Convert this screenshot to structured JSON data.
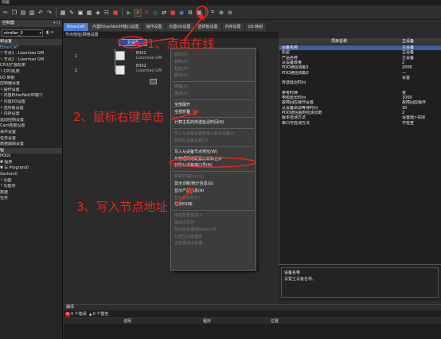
{
  "menubar": {
    "text": "动画"
  },
  "toolbar": {
    "icons": [
      "cut-icon",
      "copy-icon",
      "paste-icon",
      "delete-icon",
      "undo-icon",
      "redo-icon",
      "build-icon",
      "sync-icon",
      "online-icon",
      "offline-icon",
      "grid-icon",
      "zoom-in-icon",
      "zoom-out-icon"
    ]
  },
  "left": {
    "header": "控制器",
    "combo": "ntroller_0",
    "items": [
      {
        "label": "和设置",
        "kind": "cat"
      },
      {
        "label": "EtherCAT",
        "kind": "blue"
      },
      {
        "label": "└ 节点1 : Liaomiao GM",
        "kind": "normal"
      },
      {
        "label": "└ 节点2 : Liaomiao GM",
        "kind": "normal"
      },
      {
        "label": "CPU/扩展机架",
        "kind": "normal"
      },
      {
        "label": "└ CPU机架",
        "kind": "normal"
      },
      {
        "label": "I/O 映射",
        "kind": "normal"
      },
      {
        "label": "控制器设置",
        "kind": "normal"
      },
      {
        "label": "└ 操作设置",
        "kind": "normal"
      },
      {
        "label": "└ 内置EtherNet/IP端口",
        "kind": "normal"
      },
      {
        "label": "└ 内置I/O设置",
        "kind": "normal"
      },
      {
        "label": "└ 选项板设置",
        "kind": "normal"
      },
      {
        "label": "└ 内存设置",
        "kind": "normal"
      },
      {
        "label": "运动控制设置",
        "kind": "normal"
      },
      {
        "label": "Cam数据设置",
        "kind": "normal"
      },
      {
        "label": "事件设置",
        "kind": "normal"
      },
      {
        "label": "任务设置",
        "kind": "normal"
      },
      {
        "label": "数据跟踪设置",
        "kind": "normal"
      },
      {
        "label": "程",
        "kind": "cat"
      },
      {
        "label": "POUs",
        "kind": "normal"
      },
      {
        "label": "▼ 程序",
        "kind": "normal"
      },
      {
        "label": "▼ ☰ Program0",
        "kind": "normal"
      },
      {
        "label": "Section0",
        "kind": "normal"
      },
      {
        "label": "└ 功能",
        "kind": "normal"
      },
      {
        "label": "└ 功能块",
        "kind": "normal"
      },
      {
        "label": "数据",
        "kind": "normal"
      },
      {
        "label": "任务",
        "kind": "normal"
      }
    ]
  },
  "tabs": [
    {
      "label": "EtherCAT",
      "active": true
    },
    {
      "label": "内置EtherNet/IP端口设置",
      "active": false
    },
    {
      "label": "操作设置",
      "active": false
    },
    {
      "label": "内置I/O设置",
      "active": false
    },
    {
      "label": "选项板设置",
      "active": false
    },
    {
      "label": "内存设置",
      "active": false
    },
    {
      "label": "I/O 映射",
      "active": false
    }
  ],
  "breadcrumb": "节点地址|网络设置",
  "topology": {
    "master_label": "主设备",
    "devices": [
      {
        "num": "1",
        "name": "E001",
        "model": "Liaomiao GM"
      },
      {
        "num": "2",
        "name": "E002",
        "model": "Liaomiao GM"
      }
    ]
  },
  "context_menu": [
    {
      "label": "剪切(T)",
      "enabled": false
    },
    {
      "label": "复制(C)",
      "enabled": false
    },
    {
      "label": "粘贴(P)",
      "enabled": false
    },
    {
      "label": "删除(D)",
      "enabled": false
    },
    {
      "sep": true
    },
    {
      "label": "撤销(U)",
      "enabled": false
    },
    {
      "label": "重做(R)",
      "enabled": false
    },
    {
      "sep": true
    },
    {
      "label": "全部展开",
      "enabled": true
    },
    {
      "label": "全部折叠",
      "enabled": true
    },
    {
      "sep": true
    },
    {
      "label": "计算主机的传送延迟时间(N)",
      "enabled": true
    },
    {
      "sep": true
    },
    {
      "label": "导入从设备设置和插入新从设备(I)",
      "enabled": false
    },
    {
      "label": "导出从设备设置(X)",
      "enabled": false
    },
    {
      "sep": true
    },
    {
      "label": "写入从设备节点地址(W)",
      "enabled": true
    },
    {
      "label": "与物理网络配置比较和合并",
      "enabled": true
    },
    {
      "label": "获取从设备串口号(N)",
      "enabled": true
    },
    {
      "sep": true
    },
    {
      "label": "获取终端口计(C)",
      "enabled": false
    },
    {
      "label": "显示诊断/统计信息(G)",
      "enabled": true
    },
    {
      "label": "显示产品信息(A)",
      "enabled": true
    },
    {
      "label": "显示其信息(P)",
      "enabled": false
    },
    {
      "label": "显示ESI库",
      "enabled": true
    },
    {
      "sep": true
    },
    {
      "label": "电缆配置信息(I)",
      "enabled": false
    },
    {
      "label": "输出IO文件",
      "enabled": false
    },
    {
      "label": "导出所有模块EtherCAT",
      "enabled": false
    },
    {
      "label": "分配至功能模块",
      "enabled": false
    },
    {
      "label": "设定模块IO设置",
      "enabled": false
    }
  ],
  "properties": {
    "header_name": "项目名称",
    "header_value": "主设备",
    "rows": [
      {
        "k": "设备名称",
        "v": "主设备",
        "hl": true
      },
      {
        "k": "机型",
        "v": "主设备"
      },
      {
        "k": "产品名称",
        "v": "主设备"
      },
      {
        "k": "从设备数量",
        "v": "2"
      },
      {
        "k": "PDO通信周期1",
        "v": "2000"
      },
      {
        "k": "PDO通信周期2",
        "v": "—"
      },
      {
        "k": "",
        "v": "设置"
      },
      {
        "k": "传送延迟时间",
        "v": ""
      },
      {
        "k": "",
        "v": ""
      },
      {
        "k": "参考时钟",
        "v": "有"
      },
      {
        "k": "电缆延长时间",
        "v": "1000"
      },
      {
        "k": "故障回应操作设置",
        "v": "故障回应操作"
      },
      {
        "k": "从设备启动等待时间",
        "v": "30"
      },
      {
        "k": "PDO通信超时检测次数",
        "v": "2"
      },
      {
        "k": "版本检测方法",
        "v": "设置值>实际"
      },
      {
        "k": "串口号检测方法",
        "v": "不检查"
      }
    ]
  },
  "description": {
    "title": "设备名称",
    "text": "设置主设备名称。"
  },
  "bottom": {
    "title": "编译",
    "errors": "0 个错误",
    "warnings": "0 个警告",
    "columns": [
      "说明",
      "程序",
      "位置"
    ]
  },
  "annotations": {
    "a1": "1、点击在线",
    "a2": "2、鼠标右键单击",
    "a3": "3、写入节点地址"
  },
  "colors": {
    "annotation": "#e8261b",
    "tab_active": "#4a7bd0",
    "highlight": "#3b5fa0"
  }
}
